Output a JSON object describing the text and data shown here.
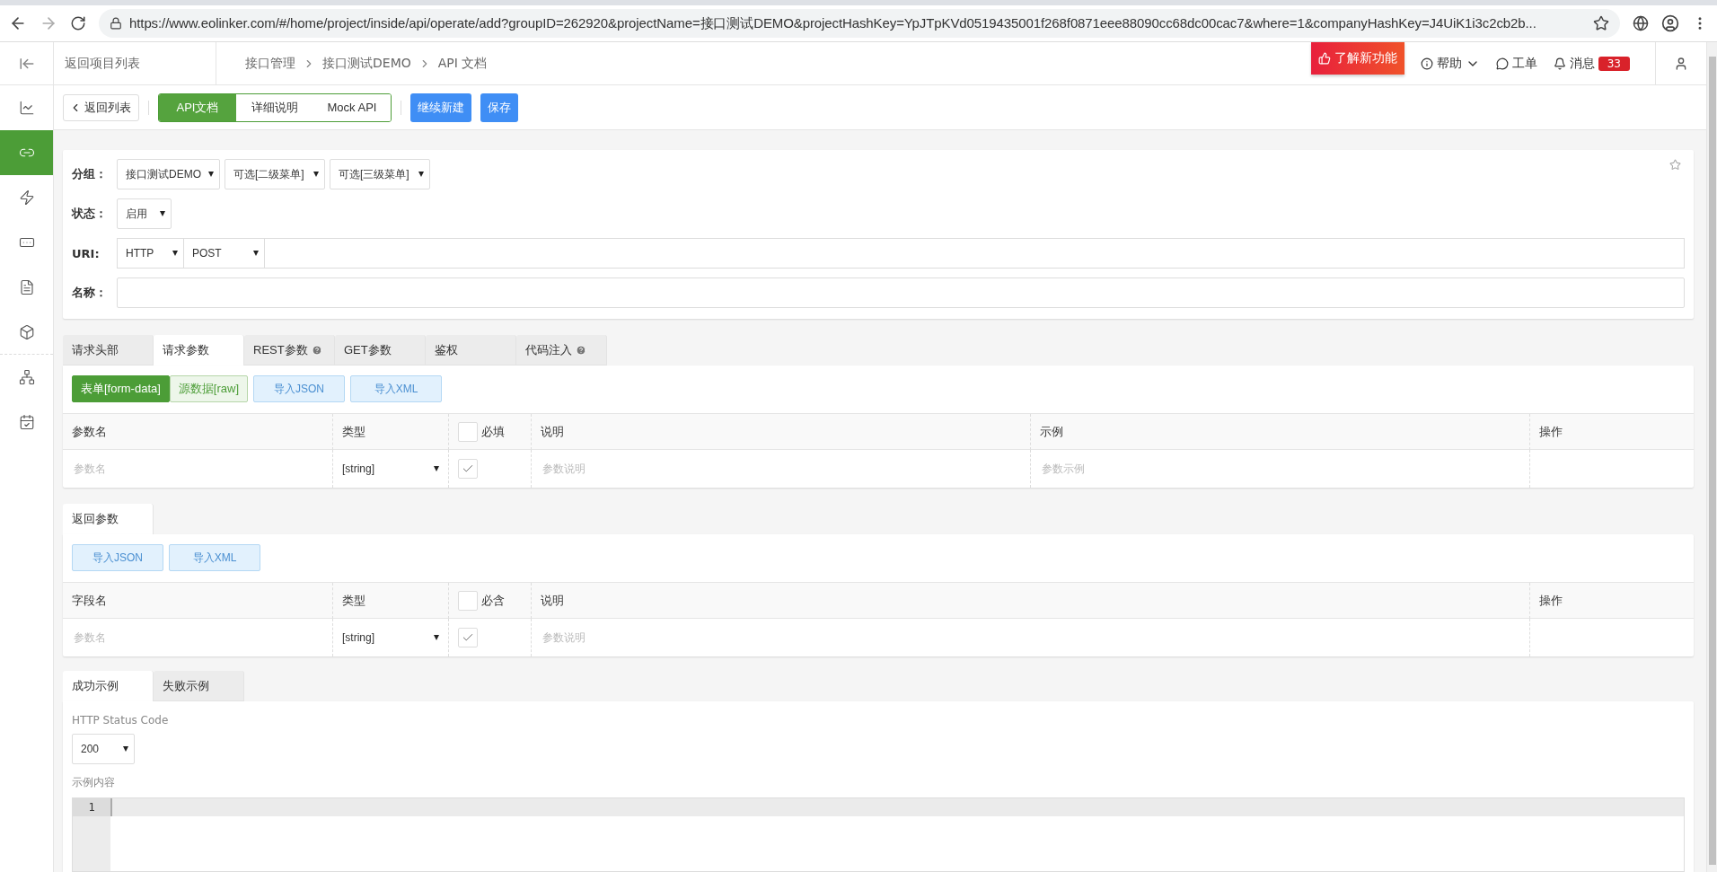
{
  "browser": {
    "url": "https://www.eolinker.com/#/home/project/inside/api/operate/add?groupID=262920&projectName=接口测试DEMO&projectHashKey=YpJTpKVd0519435001f268f0871eee88090cc68dc00cac7&where=1&companyHashKey=J4UiK1i3c2cb2b..."
  },
  "header": {
    "back_link": "返回项目列表",
    "breadcrumb": [
      "接口管理",
      "接口测试DEMO",
      "API 文档"
    ],
    "new_features": "了解新功能",
    "help": "帮助",
    "tickets": "工单",
    "messages": "消息",
    "message_count": "33"
  },
  "sidebar": {
    "items": [
      {
        "selected": false
      },
      {
        "selected": true
      },
      {
        "selected": false
      },
      {
        "selected": false
      },
      {
        "selected": false
      },
      {
        "selected": false
      },
      {
        "selected": false
      },
      {
        "selected": false
      }
    ]
  },
  "toolbar": {
    "back": "返回列表",
    "views": [
      {
        "label": "API文档",
        "selected": true
      },
      {
        "label": "详细说明",
        "selected": false
      },
      {
        "label": "Mock API",
        "selected": false
      }
    ],
    "actions": [
      "继续新建",
      "保存"
    ]
  },
  "form": {
    "group": {
      "label": "分组：",
      "selects": [
        "接口测试DEMO",
        "可选[二级菜单]",
        "可选[三级菜单]"
      ]
    },
    "status": {
      "label": "状态：",
      "value": "启用"
    },
    "uri": {
      "label": "URI:",
      "protocol": "HTTP",
      "method": "POST"
    },
    "name": {
      "label": "名称："
    }
  },
  "request": {
    "tabs": [
      {
        "label": "请求头部",
        "selected": false,
        "help": false
      },
      {
        "label": "请求参数",
        "selected": true,
        "help": false
      },
      {
        "label": "REST参数",
        "selected": false,
        "help": true
      },
      {
        "label": "GET参数",
        "selected": false,
        "help": false
      },
      {
        "label": "鉴权",
        "selected": false,
        "help": false
      },
      {
        "label": "代码注入",
        "selected": false,
        "help": true
      }
    ],
    "modes": [
      {
        "label": "表单[form-data]",
        "selected": true
      },
      {
        "label": "源数据[raw]",
        "selected": false
      }
    ],
    "imports": [
      "导入JSON",
      "导入XML"
    ],
    "table": {
      "columns": [
        {
          "kind": "name",
          "label": "参数名"
        },
        {
          "kind": "type",
          "label": "类型"
        },
        {
          "kind": "check",
          "label": "必填",
          "checked": false
        },
        {
          "kind": "desc",
          "label": "说明"
        },
        {
          "kind": "example",
          "label": "示例"
        },
        {
          "kind": "actions",
          "label": "操作"
        }
      ],
      "rows": [
        {
          "cells": [
            {
              "kind": "input",
              "placeholder": "参数名"
            },
            {
              "kind": "select",
              "value": "[string]"
            },
            {
              "kind": "checkbox",
              "checked": true
            },
            {
              "kind": "input",
              "placeholder": "参数说明"
            },
            {
              "kind": "input",
              "placeholder": "参数示例"
            },
            {
              "kind": "empty"
            }
          ]
        }
      ]
    }
  },
  "response": {
    "tabs": [
      {
        "label": "返回参数",
        "selected": true,
        "help": false
      }
    ],
    "imports": [
      "导入JSON",
      "导入XML"
    ],
    "table": {
      "columns": [
        {
          "kind": "name",
          "label": "字段名"
        },
        {
          "kind": "type",
          "label": "类型"
        },
        {
          "kind": "check",
          "label": "必含",
          "checked": false
        },
        {
          "kind": "desc",
          "label": "说明"
        },
        {
          "kind": "actions",
          "label": "操作"
        }
      ],
      "rows": [
        {
          "cells": [
            {
              "kind": "input",
              "placeholder": "参数名"
            },
            {
              "kind": "select",
              "value": "[string]"
            },
            {
              "kind": "checkbox",
              "checked": true
            },
            {
              "kind": "input",
              "placeholder": "参数说明"
            },
            {
              "kind": "empty"
            }
          ]
        }
      ]
    }
  },
  "examples": {
    "tabs": [
      {
        "label": "成功示例",
        "selected": true,
        "help": false
      },
      {
        "label": "失败示例",
        "selected": false,
        "help": false
      }
    ],
    "status_label": "HTTP Status Code",
    "status_value": "200",
    "content_label": "示例内容",
    "line_numbers": [
      "1"
    ]
  }
}
